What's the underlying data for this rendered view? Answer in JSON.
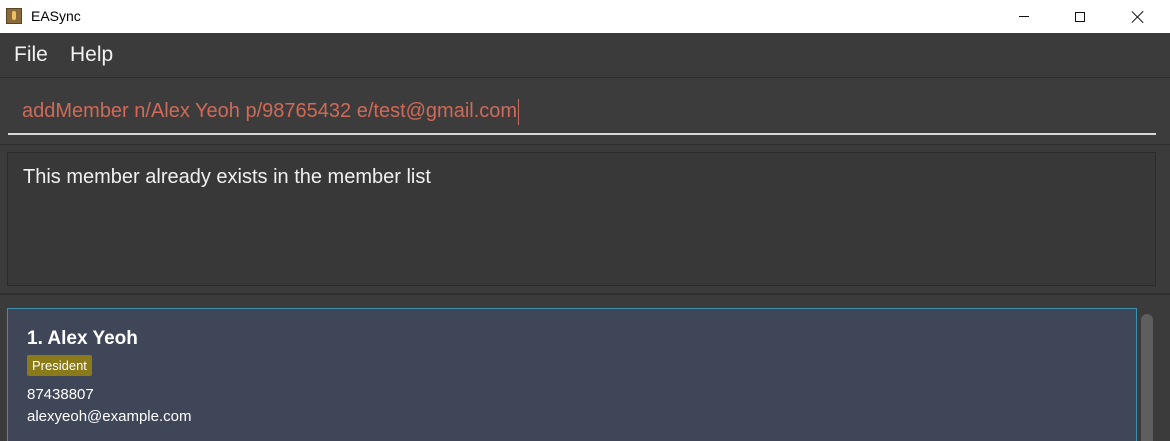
{
  "window": {
    "title": "EASync",
    "icon": "app-icon"
  },
  "menu": {
    "file_label": "File",
    "help_label": "Help"
  },
  "command": {
    "value": "addMember n/Alex Yeoh p/98765432 e/test@gmail.com",
    "text_color": "#d06a58"
  },
  "result": {
    "message": "This member already exists in the member list"
  },
  "members": [
    {
      "index_name": "1.  Alex Yeoh",
      "tag": "President",
      "phone": "87438807",
      "email": "alexyeoh@example.com"
    }
  ],
  "colors": {
    "background": "#3b3b3b",
    "card_background": "#3e4658",
    "card_border": "#3d8fb0",
    "tag_background": "#8a7a1a",
    "error_text": "#d06a58"
  }
}
